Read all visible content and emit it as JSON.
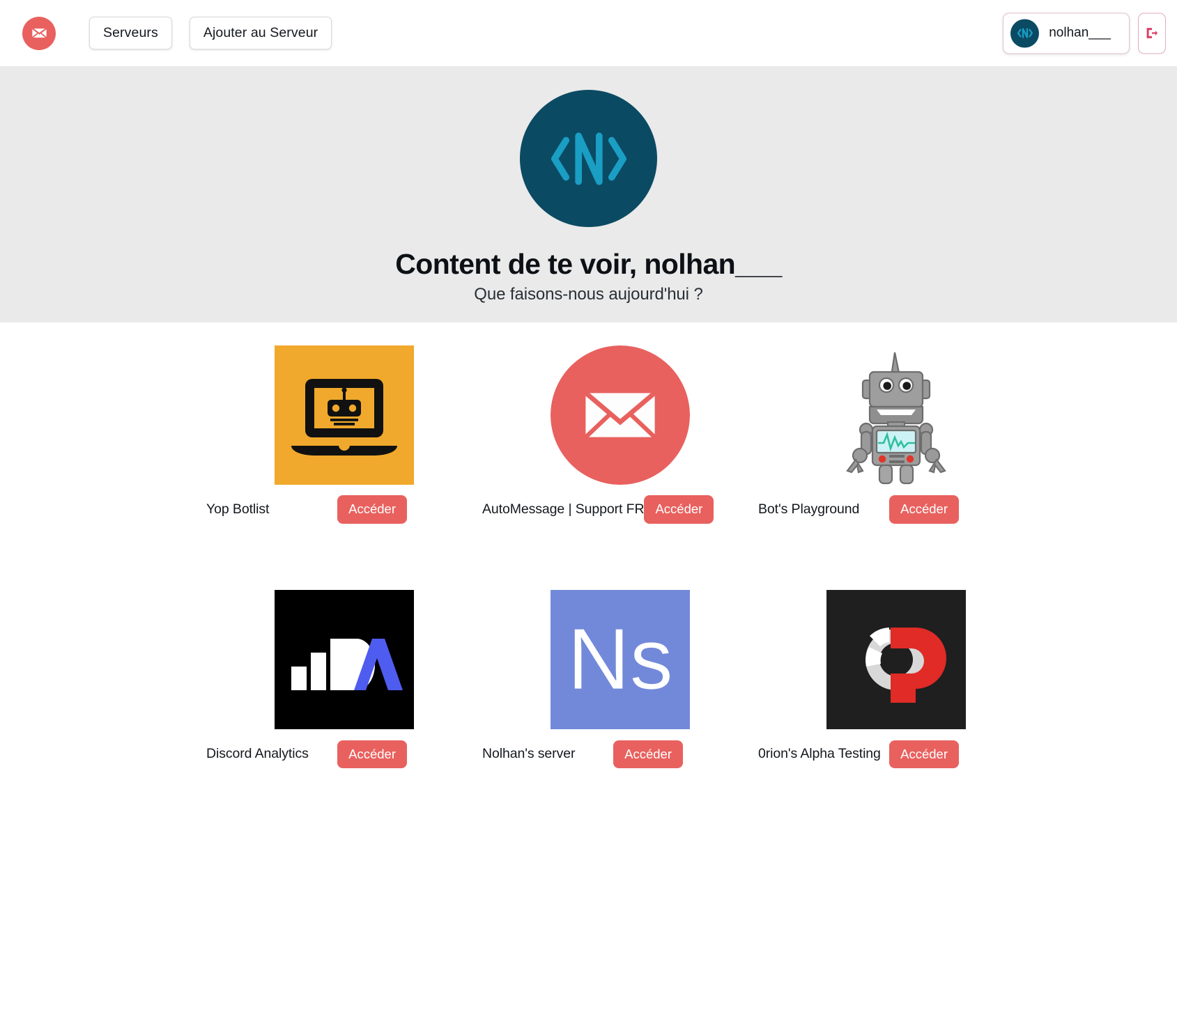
{
  "topbar": {
    "brand_icon": "envelope-icon",
    "nav": [
      {
        "label": "Serveurs",
        "name": "servers"
      },
      {
        "label": "Ajouter au Serveur",
        "name": "add-to-server"
      }
    ],
    "user": {
      "name": "nolhan___",
      "avatar_icon": "nolhan-logo-icon"
    },
    "logout_icon": "logout-icon"
  },
  "hero": {
    "logo_icon": "nolhan-logo-icon",
    "title": "Content de te voir, nolhan___",
    "subtitle": "Que faisons-nous aujourd'hui ?"
  },
  "colors": {
    "accent_red": "#e8615e",
    "brand_teal": "#0b4a63",
    "brand_cyan": "#1a9ec4",
    "hero_bg": "#eaeaea",
    "botlist_orange": "#f0a92c",
    "analytics_black": "#000000",
    "analytics_blue": "#4f5cf0",
    "ns_blue": "#7289da",
    "orion_dark": "#1f1f1f",
    "orion_red": "#e02b27"
  },
  "servers": [
    {
      "name": "Yop Botlist",
      "icon": "yop-botlist-icon",
      "button": "Accéder"
    },
    {
      "name": "AutoMessage | Support FR",
      "icon": "automessage-icon",
      "button": "Accéder"
    },
    {
      "name": "Bot's Playground",
      "icon": "bots-playground-icon",
      "button": "Accéder"
    },
    {
      "name": "Discord Analytics",
      "icon": "discord-analytics-icon",
      "button": "Accéder"
    },
    {
      "name": "Nolhan's server",
      "icon": "nolhan-server-icon",
      "button": "Accéder"
    },
    {
      "name": "0rion's Alpha Testing",
      "icon": "orion-alpha-icon",
      "button": "Accéder"
    }
  ]
}
